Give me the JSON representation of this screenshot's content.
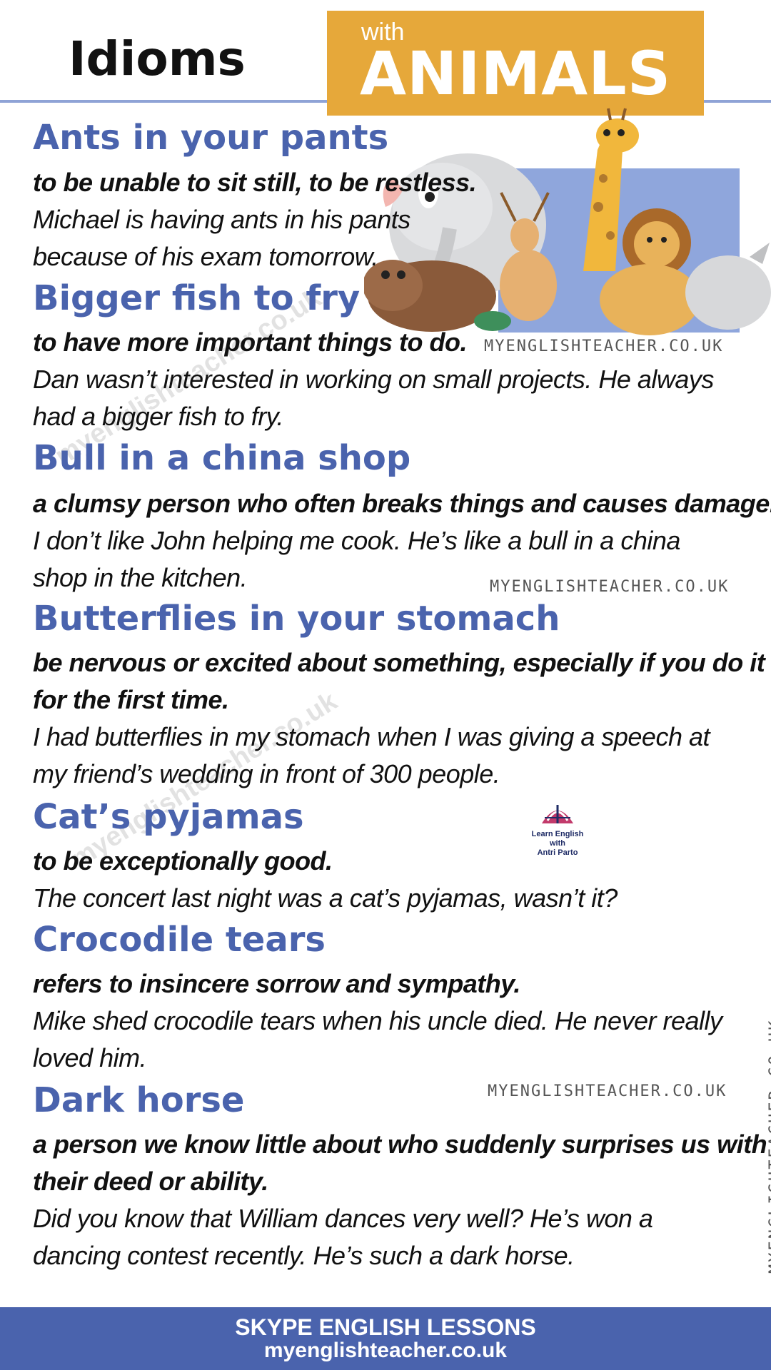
{
  "header": {
    "title_left": "Idioms",
    "title_small": "with",
    "title_big": "ANIMALS"
  },
  "watermarks": {
    "site": "MYENGLISHTEACHER.CO.UK",
    "diagonal": "myenglishteacher.co.uk"
  },
  "logo": {
    "line1": "Learn English",
    "line2": "with",
    "line3": "Antri Parto"
  },
  "idioms": [
    {
      "title": "Ants in your pants",
      "definition": [
        "to be unable to sit still, to be restless."
      ],
      "example": [
        "Michael is having ants in his pants",
        "because of his exam tomorrow."
      ]
    },
    {
      "title": "Bigger fish to fry",
      "definition": [
        "to have more important things to do."
      ],
      "example": [
        "Dan wasn’t interested in working on small projects. He always",
        "had a bigger fish to fry."
      ]
    },
    {
      "title": "Bull in a china shop",
      "definition": [
        "a clumsy person who often breaks things and causes damage."
      ],
      "example": [
        "I don’t like John helping me cook. He’s like a bull in a china",
        "shop in the kitchen."
      ]
    },
    {
      "title": "Butterflies in your stomach",
      "definition": [
        "be nervous or excited about something, especially if you do it",
        "for the first time."
      ],
      "example": [
        "I had butterflies in my stomach when I was giving a speech at",
        "my friend’s wedding in front of 300 people."
      ]
    },
    {
      "title": "Cat’s pyjamas",
      "definition": [
        "to be exceptionally good."
      ],
      "example": [
        "The concert last night was a cat’s pyjamas, wasn’t it?"
      ]
    },
    {
      "title": "Crocodile tears",
      "definition": [
        "refers to insincere sorrow and sympathy."
      ],
      "example": [
        "Mike shed crocodile tears when his uncle died. He never really",
        "loved him."
      ]
    },
    {
      "title": "Dark horse",
      "definition": [
        "a person we know little about who suddenly surprises us with",
        "their deed or ability."
      ],
      "example": [
        "Did you know that William dances very well? He’s won a",
        "dancing contest recently. He’s such a dark horse."
      ]
    }
  ],
  "footer": {
    "line1": "SKYPE ENGLISH LESSONS",
    "line2": "myenglishteacher.co.uk"
  },
  "colors": {
    "title_blue": "#4a63ad",
    "orange": "#e6a83a",
    "footer_blue": "#4a63ad"
  }
}
